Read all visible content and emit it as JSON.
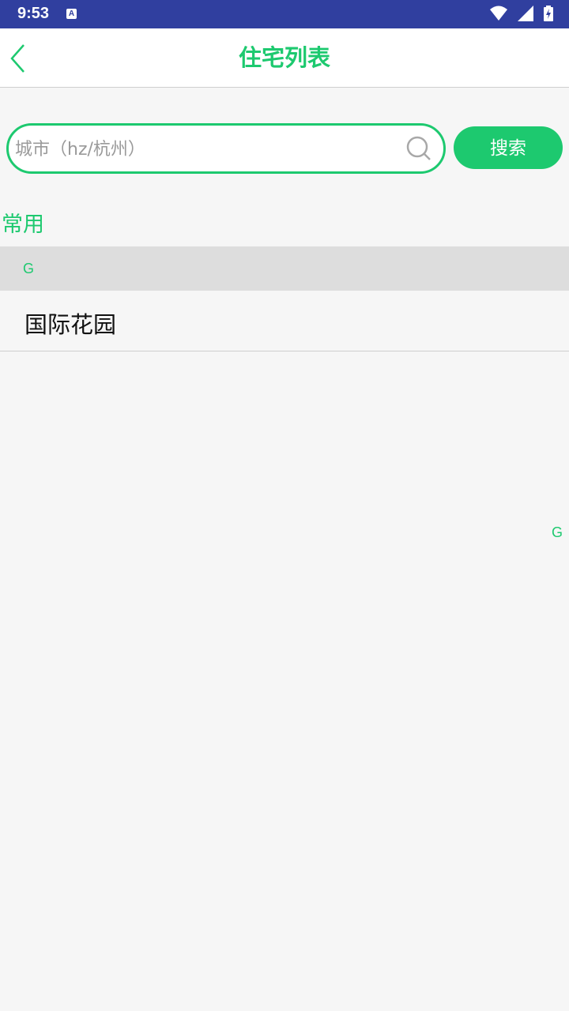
{
  "status_bar": {
    "time": "9:53",
    "notification_icon": "A",
    "icons": [
      "wifi-icon",
      "signal-icon",
      "battery-charging-icon"
    ]
  },
  "header": {
    "title": "住宅列表",
    "back_icon": "chevron-left-icon"
  },
  "search": {
    "placeholder": "城市（hz/杭州）",
    "value": "",
    "button_label": "搜索",
    "icon": "search-icon"
  },
  "common_label": "常用",
  "groups": [
    {
      "letter": "G",
      "items": [
        "国际花园"
      ]
    }
  ],
  "index_bar": [
    "G"
  ],
  "colors": {
    "accent": "#1dc96f",
    "status_bar": "#303f9f",
    "background": "#f6f6f6",
    "group_header": "#dddddd"
  }
}
